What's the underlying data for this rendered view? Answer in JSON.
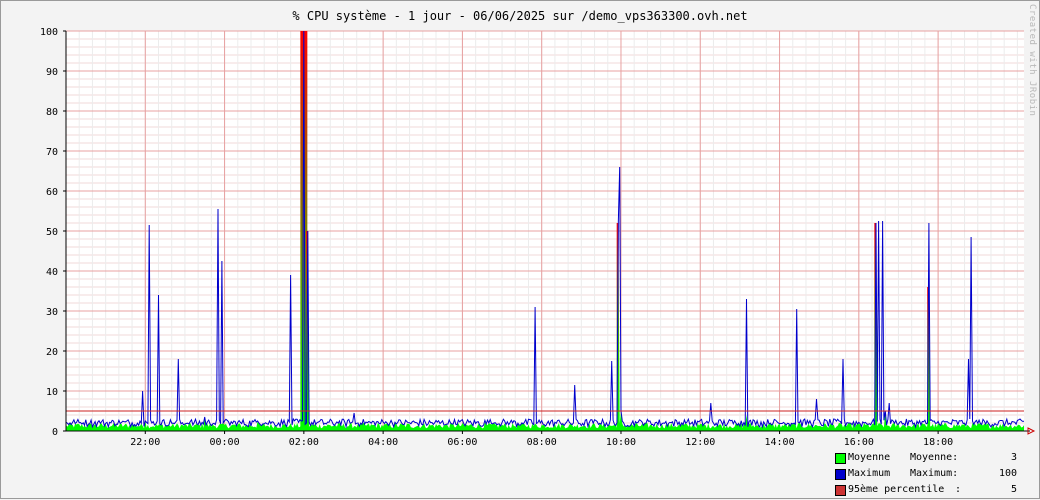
{
  "title": "% CPU système - 1 jour - 06/06/2025 sur /demo_vps363300.ovh.net",
  "watermark": "Created with JRobin",
  "chart_data": {
    "type": "area",
    "title": "% CPU système - 1 jour - 06/06/2025 sur /demo_vps363300.ovh.net",
    "ylim": [
      0,
      100
    ],
    "yticks": [
      0,
      10,
      20,
      30,
      40,
      50,
      60,
      70,
      80,
      90,
      100
    ],
    "xlim": [
      "20:00",
      "20:10 (+1 day)"
    ],
    "xticks": [
      "22:00",
      "00:00",
      "02:00",
      "04:00",
      "06:00",
      "08:00",
      "10:00",
      "12:00",
      "14:00",
      "16:00",
      "18:00"
    ],
    "grid": true,
    "colors": {
      "average": "#00ff00",
      "maximum": "#0000cc",
      "percentile": "#cc2222",
      "peak_top": "#ff0000",
      "grid": "#e8a0a0"
    },
    "percentile_value": 5,
    "series": [
      {
        "name": "Moyenne",
        "baseline": 1.2,
        "peaks": [
          {
            "x": "22:00",
            "y": 2.5
          },
          {
            "x": "23:30",
            "y": 3.5
          },
          {
            "x": "00:50",
            "y": 2.5
          },
          {
            "x": "02:00",
            "y": 100
          },
          {
            "x": "02:05",
            "y": 50
          },
          {
            "x": "09:55",
            "y": 52
          },
          {
            "x": "10:00",
            "y": 5
          },
          {
            "x": "13:10",
            "y": 4
          },
          {
            "x": "16:25",
            "y": 52
          },
          {
            "x": "16:40",
            "y": 5
          },
          {
            "x": "17:45",
            "y": 36
          }
        ]
      },
      {
        "name": "Maximum",
        "baseline": 1.8,
        "peaks": [
          {
            "x": "21:55",
            "y": 10
          },
          {
            "x": "22:05",
            "y": 51.5
          },
          {
            "x": "22:20",
            "y": 34
          },
          {
            "x": "22:50",
            "y": 18
          },
          {
            "x": "23:50",
            "y": 55.5
          },
          {
            "x": "23:55",
            "y": 42.5
          },
          {
            "x": "01:40",
            "y": 39
          },
          {
            "x": "02:00",
            "y": 100
          },
          {
            "x": "02:05",
            "y": 49
          },
          {
            "x": "03:15",
            "y": 4.5
          },
          {
            "x": "07:50",
            "y": 31
          },
          {
            "x": "08:50",
            "y": 11.5
          },
          {
            "x": "09:45",
            "y": 17.5
          },
          {
            "x": "09:55",
            "y": 52
          },
          {
            "x": "09:58",
            "y": 66
          },
          {
            "x": "12:15",
            "y": 7
          },
          {
            "x": "13:10",
            "y": 33
          },
          {
            "x": "14:25",
            "y": 30.5
          },
          {
            "x": "14:55",
            "y": 8
          },
          {
            "x": "15:35",
            "y": 18
          },
          {
            "x": "16:25",
            "y": 52
          },
          {
            "x": "16:30",
            "y": 52.5
          },
          {
            "x": "16:35",
            "y": 52.5
          },
          {
            "x": "16:45",
            "y": 7
          },
          {
            "x": "17:45",
            "y": 52
          },
          {
            "x": "18:45",
            "y": 18
          },
          {
            "x": "18:50",
            "y": 48.5
          }
        ]
      }
    ]
  },
  "legend": [
    {
      "name": "Moyenne",
      "label": "Moyenne:",
      "colon": "",
      "value": "3",
      "color": "#00ff00"
    },
    {
      "name": "Maximum",
      "label": "Maximum:",
      "colon": "",
      "value": "100",
      "color": "#0000cc"
    },
    {
      "name": "95ème percentile",
      "label": "",
      "colon": ":",
      "value": "5",
      "color": "#cc3333"
    }
  ]
}
